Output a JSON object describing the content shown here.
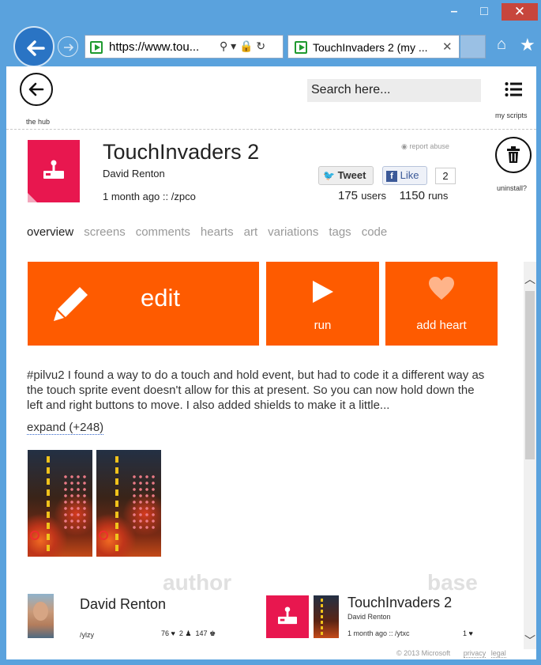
{
  "window": {
    "minimize": "–",
    "maximize": "□",
    "close": "✕"
  },
  "browser": {
    "address": "https://www.tou...",
    "address_icons": "⚲ ▾ 🔒 ↻",
    "tab_title": "TouchInvaders 2 (my ...",
    "tab_close": "✕",
    "home": "⌂",
    "favorites": "★"
  },
  "header": {
    "hub_label": "the hub",
    "search_placeholder": "Search here...",
    "myscripts_label": "my scripts"
  },
  "script": {
    "title": "TouchInvaders 2",
    "author": "David Renton",
    "meta": "1 month ago :: /zpco",
    "report": "report abuse",
    "tweet_label": "Tweet",
    "like_label": "Like",
    "like_count": "2",
    "users_count": "175",
    "users_label": "users",
    "runs_count": "1150",
    "runs_label": "runs",
    "uninstall_label": "uninstall?"
  },
  "tabs": [
    {
      "label": "overview",
      "active": true
    },
    {
      "label": "screens"
    },
    {
      "label": "comments"
    },
    {
      "label": "hearts"
    },
    {
      "label": "art"
    },
    {
      "label": "variations"
    },
    {
      "label": "tags"
    },
    {
      "label": "code"
    }
  ],
  "actions": {
    "edit": "edit",
    "run": "run",
    "heart": "add heart"
  },
  "description": {
    "text": "#pilvu2 I found a way to do a touch and hold event, but had to code it a different way as the touch sprite event doesn't allow for this at present. So you can now hold down the left and right buttons to move. I also added shields to make it a little...",
    "expand": "expand (+248)"
  },
  "sections": {
    "author_heading": "author",
    "base_heading": "base"
  },
  "author_card": {
    "name": "David Renton",
    "handle": "/ylzy",
    "hearts": "76",
    "followers": "2",
    "scripts": "147"
  },
  "base_card": {
    "title": "TouchInvaders 2",
    "author": "David Renton",
    "meta": "1 month ago :: /ytxc",
    "hearts": "1"
  },
  "footer": {
    "copyright": "© 2013 Microsoft",
    "privacy": "privacy",
    "legal": "legal"
  },
  "colors": {
    "accent_orange": "#fe5b00",
    "script_pink": "#e8174f",
    "window_blue": "#5aa2dd"
  },
  "icons": {
    "back": "arrow-left-icon",
    "my_scripts": "list-icon",
    "uninstall": "trash-icon",
    "edit": "pencil-icon",
    "run": "play-icon",
    "heart": "heart-icon",
    "script": "joystick-icon"
  }
}
